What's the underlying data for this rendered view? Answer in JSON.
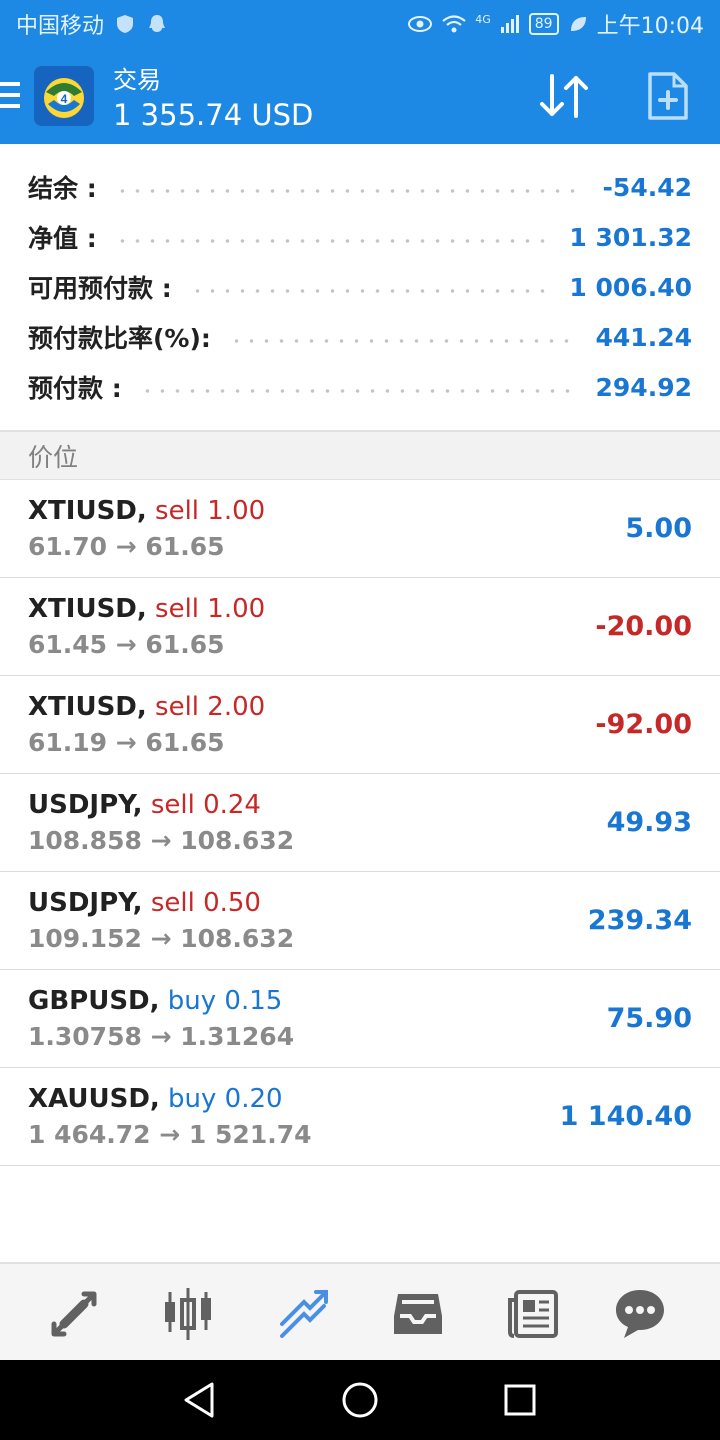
{
  "status_bar": {
    "carrier": "中国移动",
    "battery": "89",
    "time": "上午10:04",
    "network": "4G"
  },
  "header": {
    "title": "交易",
    "balance": "1 355.74 USD"
  },
  "summary": [
    {
      "label": "结余 :",
      "value": "-54.42"
    },
    {
      "label": "净值 :",
      "value": "1 301.32"
    },
    {
      "label": "可用预付款 :",
      "value": "1 006.40"
    },
    {
      "label": "预付款比率(%):",
      "value": "441.24"
    },
    {
      "label": "预付款 :",
      "value": "294.92"
    }
  ],
  "section_title": "价位",
  "positions": [
    {
      "symbol": "XTIUSD,",
      "type": "sell 1.00",
      "prices": "61.70 → 61.65",
      "profit": "5.00"
    },
    {
      "symbol": "XTIUSD,",
      "type": "sell 1.00",
      "prices": "61.45 → 61.65",
      "profit": "-20.00"
    },
    {
      "symbol": "XTIUSD,",
      "type": "sell 2.00",
      "prices": "61.19 → 61.65",
      "profit": "-92.00"
    },
    {
      "symbol": "USDJPY,",
      "type": "sell 0.24",
      "prices": "108.858 → 108.632",
      "profit": "49.93"
    },
    {
      "symbol": "USDJPY,",
      "type": "sell 0.50",
      "prices": "109.152 → 108.632",
      "profit": "239.34"
    },
    {
      "symbol": "GBPUSD,",
      "type": "buy 0.15",
      "prices": "1.30758 → 1.31264",
      "profit": "75.90"
    },
    {
      "symbol": "XAUUSD,",
      "type": "buy 0.20",
      "prices": "1 464.72 → 1 521.74",
      "profit": "1 140.40"
    }
  ],
  "toolbar": {
    "items": [
      "quotes-icon",
      "chart-icon",
      "trade-icon",
      "history-icon",
      "news-icon",
      "chat-icon"
    ],
    "active": "trade-icon"
  },
  "colors": {
    "accent": "#1e88e5",
    "positive": "#1976d2",
    "negative": "#c62828",
    "muted": "#8a8a8a"
  }
}
